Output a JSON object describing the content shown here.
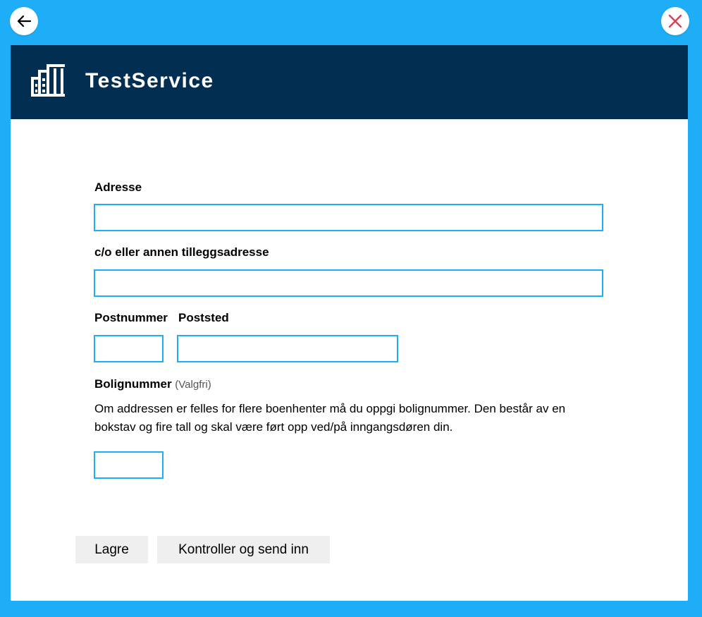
{
  "app": {
    "title": "TestService"
  },
  "nav": {
    "back_icon": "arrow-left-icon",
    "close_icon": "close-x-icon",
    "close_color": "#e23b53"
  },
  "colors": {
    "background": "#1eaef7",
    "header": "#022f51",
    "input_border": "#1eaef7"
  },
  "form": {
    "address": {
      "label": "Adresse",
      "value": ""
    },
    "co_address": {
      "label": "c/o eller annen tilleggsadresse",
      "value": ""
    },
    "postal_code": {
      "label": "Postnummer",
      "value": ""
    },
    "postal_place": {
      "label": "Poststed",
      "value": ""
    },
    "apartment": {
      "label": "Bolignummer",
      "optional": "(Valgfri)",
      "description": "Om addressen er felles for flere boenhenter må du oppgi bolignummer. Den består av en bokstav og fire tall og skal være ført opp ved/på inngangsdøren din.",
      "value": ""
    }
  },
  "actions": {
    "save": "Lagre",
    "submit": "Kontroller og send inn"
  }
}
